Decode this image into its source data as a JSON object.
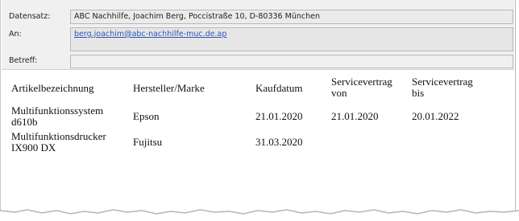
{
  "header": {
    "datensatz_label": "Datensatz:",
    "datensatz_value": "ABC Nachhilfe,  Joachim Berg,  Poccistraße 10,  D-80336 München",
    "an_label": "An:",
    "an_value": "berg.joachim@abc-nachhilfe-muc.de.ap",
    "betreff_label": "Betreff:",
    "betreff_value": ""
  },
  "table": {
    "headers": {
      "artikel": "Artikelbezeichnung",
      "hersteller": "Hersteller/Marke",
      "kaufdatum": "Kaufdatum",
      "von_1": "Servicevertrag",
      "von_2": "von",
      "bis_1": "Servicevertrag",
      "bis_2": "bis"
    },
    "rows": [
      {
        "artikel_1": "Multifunktionssystem",
        "artikel_2": "d610b",
        "hersteller": "Epson",
        "kaufdatum": "21.01.2020",
        "von": "21.01.2020",
        "bis": "20.01.2022"
      },
      {
        "artikel_1": "Multifunktionsdrucker",
        "artikel_2": "IX900 DX",
        "hersteller": "Fujitsu",
        "kaufdatum": "31.03.2020",
        "von": "",
        "bis": ""
      }
    ]
  },
  "colors": {
    "link": "#2b57b8",
    "header_bg": "#f0f0f0"
  }
}
